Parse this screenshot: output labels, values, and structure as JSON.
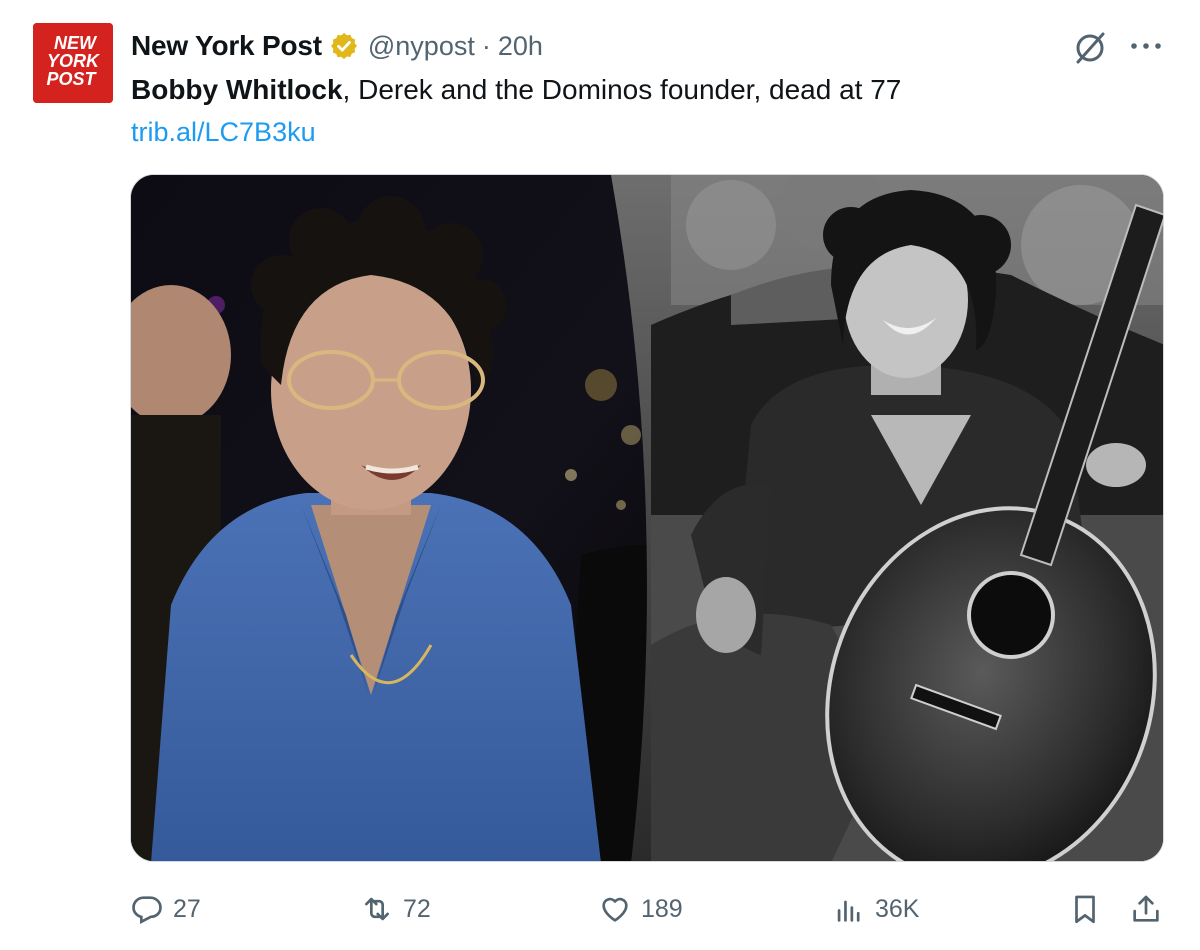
{
  "tweet": {
    "avatar_text": [
      "NEW",
      "YORK",
      "POST"
    ],
    "display_name": "New York Post",
    "handle": "@nypost",
    "separator": "·",
    "time": "20h",
    "text_bold": "Bobby Whitlock",
    "text_rest": ", Derek and the Dominos founder, dead at 77",
    "link": "trib.al/LC7B3ku"
  },
  "actions": {
    "replies": "27",
    "reposts": "72",
    "likes": "189",
    "views": "36K"
  },
  "colors": {
    "brand_red": "#d4231f",
    "link_blue": "#1d9bf0",
    "muted": "#536471",
    "verified_gold": "#e2b719"
  }
}
